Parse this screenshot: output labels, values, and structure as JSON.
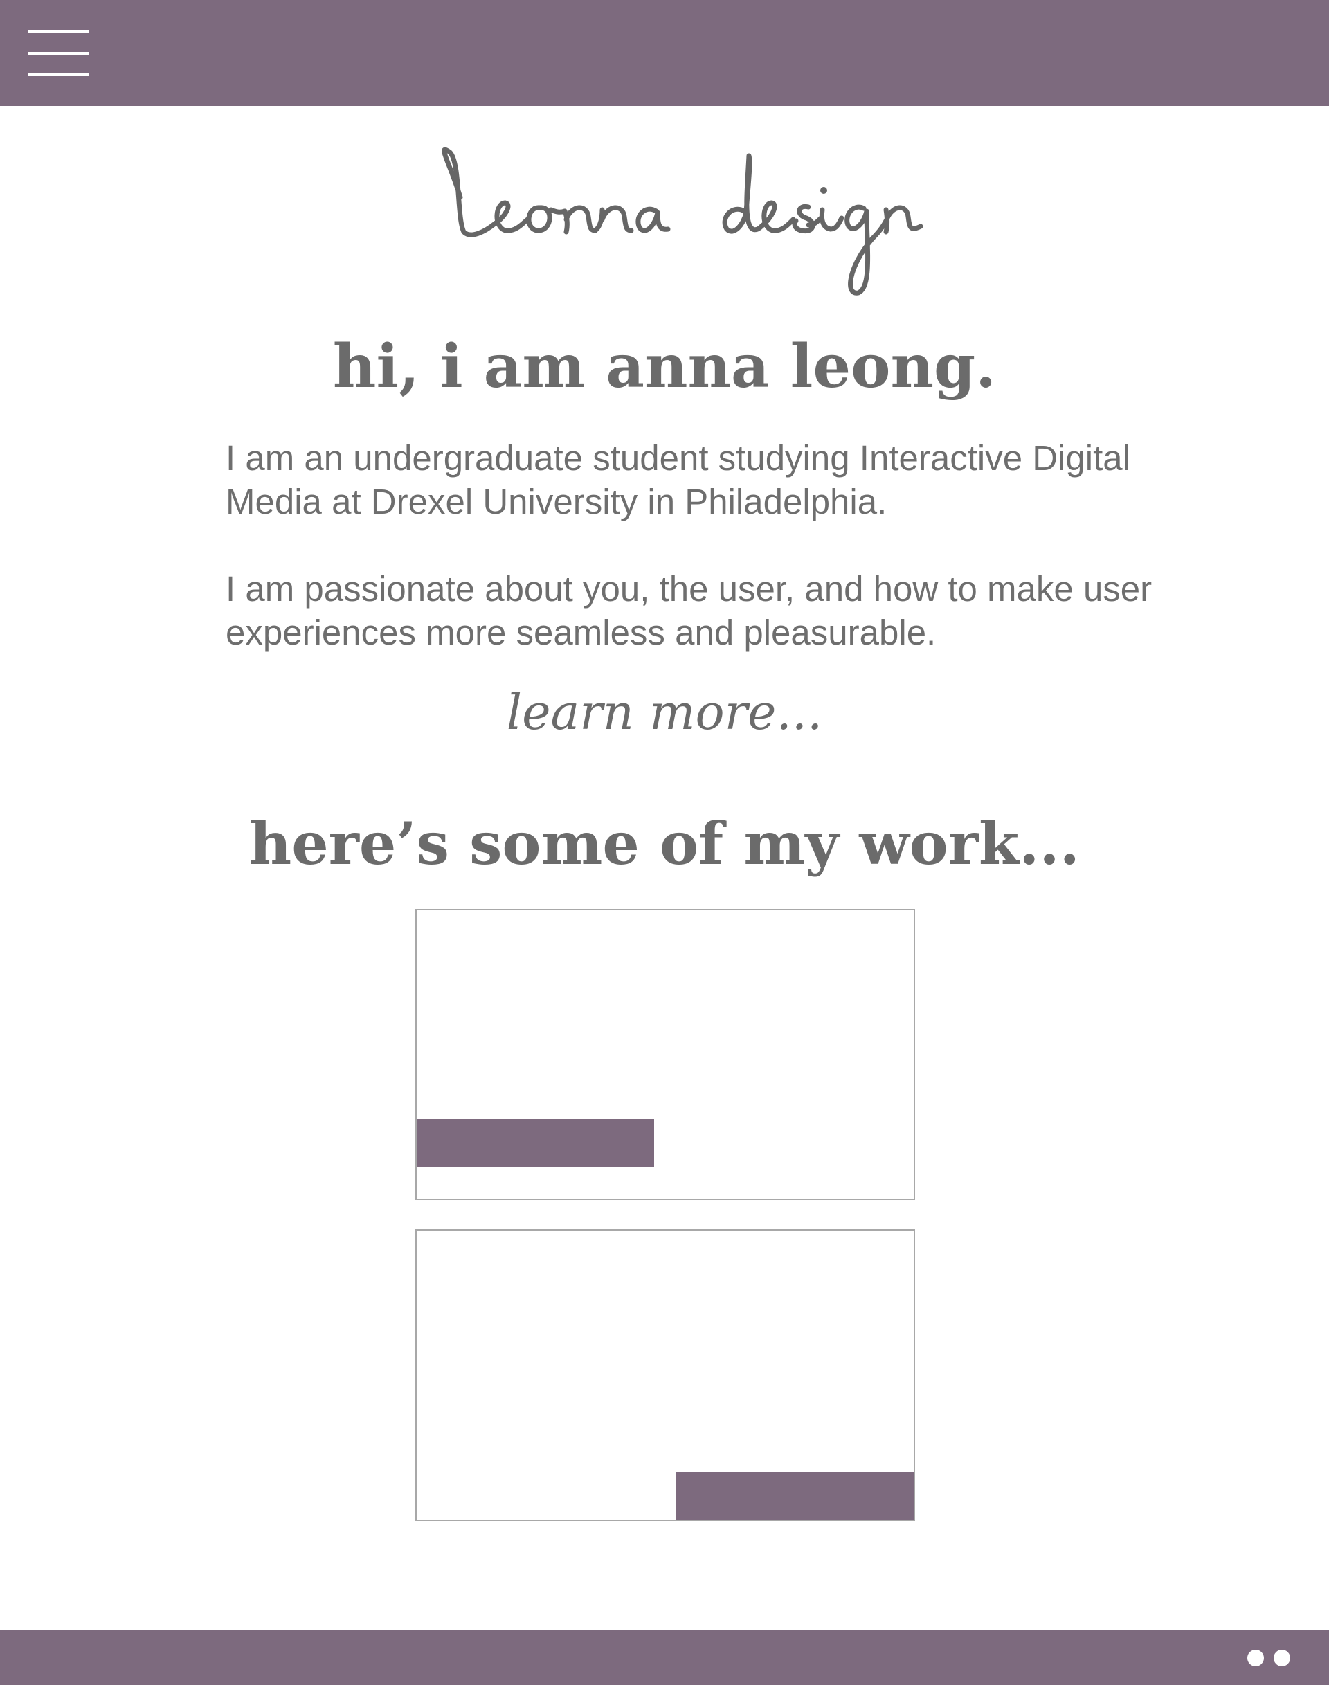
{
  "header": {
    "menu_icon": "hamburger-menu-icon",
    "background_color": "#7d6a7e"
  },
  "brand": {
    "logo_text": "leonna design",
    "logo_color": "#5f5f5f"
  },
  "intro": {
    "heading": "hi, i am anna leong.",
    "paragraph_1": "I am an undergraduate student studying Interactive Digital Media at Drexel University in Philadelphia.",
    "paragraph_2": "I am passionate about you, the user, and how to make user experiences more seamless and pleasurable.",
    "learn_more": "learn more..."
  },
  "work": {
    "heading": "here’s some of my work...",
    "cards": [
      {
        "label_position": "bottom-left"
      },
      {
        "label_position": "bottom-right"
      }
    ]
  },
  "footer": {
    "pager_dots": 2,
    "background_color": "#7d6a7e"
  }
}
